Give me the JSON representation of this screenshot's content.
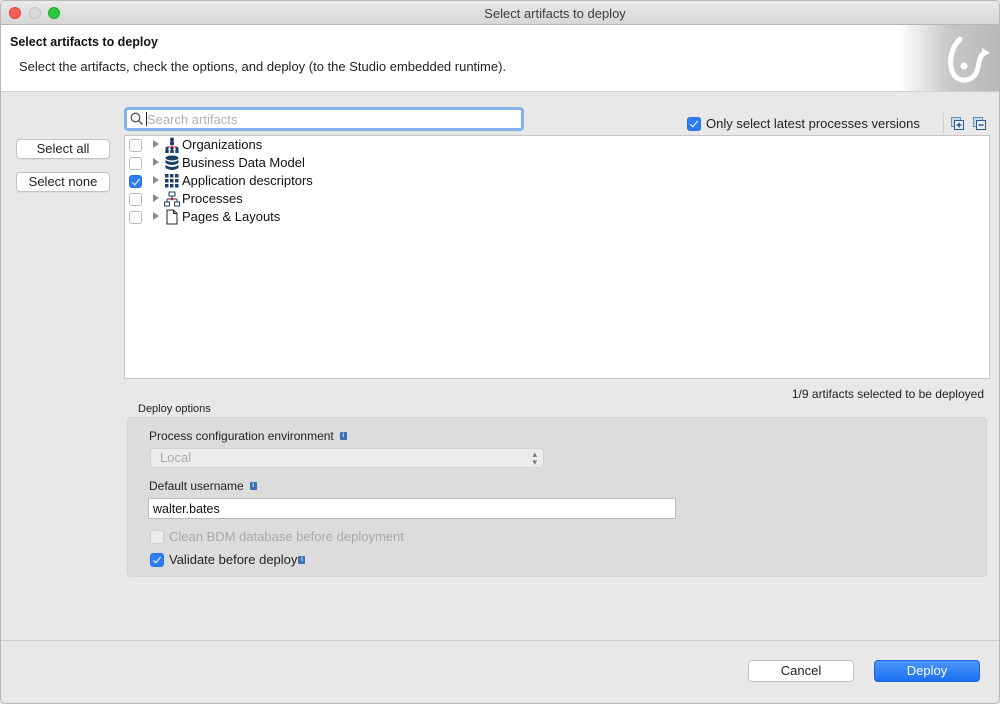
{
  "window": {
    "title": "Select artifacts to deploy"
  },
  "header": {
    "title": "Select artifacts to deploy",
    "description": "Select the artifacts, check the options, and deploy (to the Studio embedded runtime).",
    "logo_icon": "bonita-logo-icon"
  },
  "sidebar": {
    "select_all_label": "Select all",
    "select_none_label": "Select none"
  },
  "search": {
    "placeholder": "Search artifacts",
    "value": "",
    "icon": "search-icon"
  },
  "options_bar": {
    "only_latest_label": "Only select latest processes versions",
    "only_latest_checked": true,
    "expand_all_icon": "expand-all-icon",
    "collapse_all_icon": "collapse-all-icon"
  },
  "tree": {
    "items": [
      {
        "label": "Organizations",
        "checked": false,
        "icon": "organization-icon"
      },
      {
        "label": "Business Data Model",
        "checked": false,
        "icon": "database-icon"
      },
      {
        "label": "Application descriptors",
        "checked": true,
        "icon": "grid-icon"
      },
      {
        "label": "Processes",
        "checked": false,
        "icon": "process-diagram-icon"
      },
      {
        "label": "Pages & Layouts",
        "checked": false,
        "icon": "page-icon"
      }
    ]
  },
  "selection_count": "1/9 artifacts selected to be deployed",
  "deploy_options": {
    "legend": "Deploy options",
    "env_label": "Process configuration environment",
    "env_value": "Local",
    "username_label": "Default username",
    "username_value": "walter.bates",
    "clean_bdm_label": "Clean BDM database before deployment",
    "clean_bdm_checked": false,
    "clean_bdm_disabled": true,
    "validate_label": "Validate before deploy",
    "validate_checked": true
  },
  "footer": {
    "cancel_label": "Cancel",
    "deploy_label": "Deploy"
  },
  "colors": {
    "accent": "#2d7cf6",
    "info_badge": "#3d6fb5",
    "icon_navy": "#1e3f66",
    "icon_red": "#d0202a"
  }
}
